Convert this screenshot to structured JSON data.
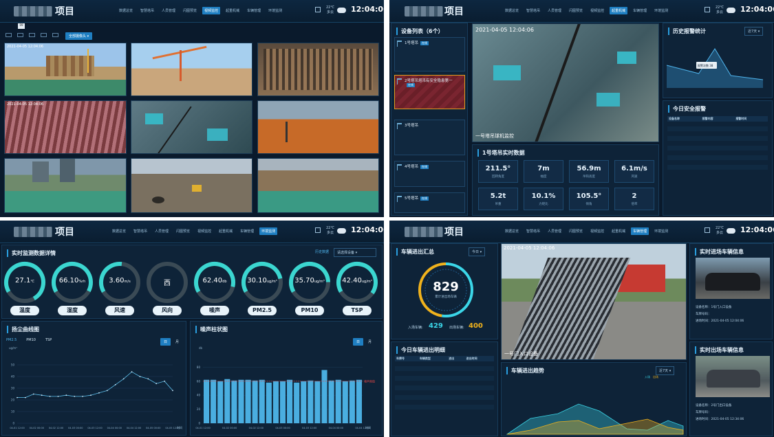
{
  "nav": [
    "数据总览",
    "智慧塔吊",
    "人员管理",
    "闪图预览",
    "视频监控",
    "起重机械",
    "车辆管理",
    "环境监测"
  ],
  "project_suffix": "项目",
  "time": "12:04:06",
  "weather": {
    "temp": "22℃",
    "desc": "多云",
    "icon": "cloud-icon"
  },
  "colors": {
    "accent": "#1f7fc2",
    "cyan": "#3bd6e8",
    "bg": "#0a1a2c"
  },
  "q1": {
    "top_label": "09",
    "dropdown": "全部摄像头",
    "cams": [
      {
        "ts": "2021-04-05 12:04:06",
        "scene": "sky-yellow"
      },
      {
        "ts": "",
        "scene": "sky-concrete"
      },
      {
        "ts": "",
        "scene": "rebar"
      },
      {
        "ts": "2021-04-05 12:04:06",
        "scene": "rebar-red"
      },
      {
        "ts": "",
        "scene": "crane-top"
      },
      {
        "ts": "",
        "scene": "orange-soil"
      },
      {
        "ts": "",
        "scene": "buildings"
      },
      {
        "ts": "",
        "scene": "workers"
      },
      {
        "ts": "",
        "scene": "site-wide"
      }
    ]
  },
  "q2": {
    "device_list_title": "设备列表（6个）",
    "devices": [
      {
        "name": "1号塔吊",
        "tag": "在线"
      },
      {
        "name": "2号塔吊塔吊有安全隐患第一",
        "tag": "在线",
        "alarm": true
      },
      {
        "name": "3号塔吊",
        "tag": ""
      },
      {
        "name": "4号塔吊",
        "tag": "在线"
      },
      {
        "name": "5号塔吊",
        "tag": "在线"
      }
    ],
    "video_ts": "2021-04-05 12:04:06",
    "video_caption": "一号塔吊球机监控",
    "realtime_title": "1号塔吊实时数据",
    "metrics": [
      {
        "v": "211.5°",
        "l": "回转角度"
      },
      {
        "v": "7m",
        "l": "幅度"
      },
      {
        "v": "56.9m",
        "l": "吊钩高度"
      },
      {
        "v": "6.1m/s",
        "l": "风速"
      },
      {
        "v": "5.2t",
        "l": "吊重"
      },
      {
        "v": "10.1%",
        "l": "力矩比"
      },
      {
        "v": "105.5°",
        "l": "倾角"
      },
      {
        "v": "2",
        "l": "倍率"
      }
    ],
    "history_title": "历史报警统计",
    "history_select": "近7天",
    "history_chart": {
      "type": "area",
      "values": [
        22,
        18,
        14,
        38,
        12,
        10,
        8
      ],
      "tooltip": "报警次数 38"
    },
    "safety_title": "今日安全报警",
    "safety_headers": [
      "设备名称",
      "报警内容",
      "报警时间"
    ],
    "safety_rows": 10
  },
  "q3": {
    "monitor_title": "实时监测数据详情",
    "monitor_link": "历史数据",
    "monitor_select": "请选择设备",
    "gauges": [
      {
        "v": "27.1",
        "u": "℃",
        "l": "温度",
        "p": 0.75
      },
      {
        "v": "66.10",
        "u": "%rh",
        "l": "湿度",
        "p": 0.66
      },
      {
        "v": "3.60",
        "u": "m/s",
        "l": "风速",
        "p": 0.35
      },
      {
        "v": "西",
        "u": "",
        "l": "风向",
        "p": 0
      },
      {
        "v": "62.40",
        "u": "db",
        "l": "噪声",
        "p": 0.62
      },
      {
        "v": "30.10",
        "u": "ug/m³",
        "l": "PM2.5",
        "p": 0.55
      },
      {
        "v": "35.70",
        "u": "ug/m³",
        "l": "PM10",
        "p": 0.58
      },
      {
        "v": "42.40",
        "u": "ug/m³",
        "l": "TSP",
        "p": 0.68
      }
    ],
    "dust_title": "扬尘曲线图",
    "dust_tabs": [
      "PM2.5",
      "PM10",
      "TSP"
    ],
    "dust_unit": "ug/m³",
    "dust_btns": [
      "日",
      "月"
    ],
    "noise_title": "噪声柱状图",
    "noise_unit": "db",
    "noise_limit": "噪声限值",
    "x_axis_label": "时间"
  },
  "chart_data": [
    {
      "type": "line",
      "ylabel": "ug/m³",
      "ylim": [
        0,
        60
      ],
      "yticks": [
        0,
        10,
        20,
        30,
        40,
        50
      ],
      "x": [
        "04-01 12:00",
        "04-02 00:00",
        "04-02 12:00",
        "04-03 00:00",
        "04-03 12:00",
        "04-04 00:00",
        "04-04 12:00",
        "04-05 00:00",
        "04-05 12:00"
      ],
      "values": [
        22,
        22,
        25,
        24,
        23,
        23,
        24,
        23,
        23,
        24,
        26,
        28,
        33,
        38,
        44,
        40,
        38,
        34,
        36,
        28
      ]
    },
    {
      "type": "bar",
      "ylabel": "db",
      "ylim": [
        0,
        100
      ],
      "yticks": [
        0,
        20,
        40,
        60,
        80
      ],
      "x": [
        "04-01 12:00",
        "04-02 00:00",
        "04-02 12:00",
        "04-03 00:00",
        "04-03 12:00",
        "04-04 00:00",
        "04-04 12:00"
      ],
      "values": [
        62,
        62,
        60,
        63,
        61,
        62,
        62,
        61,
        62,
        58,
        60,
        60,
        62,
        58,
        60,
        61,
        60,
        76,
        61,
        62,
        60,
        61,
        62
      ],
      "limit": 60
    }
  ],
  "q4": {
    "summary_title": "车辆进出汇总",
    "summary_select": "今日",
    "total": "829",
    "total_label": "累计进出场车辆",
    "in_label": "入场车辆:",
    "in_value": "429",
    "out_label": "出场车辆:",
    "out_value": "400",
    "detail_title": "今日车辆进出明细",
    "detail_headers": [
      "车牌号",
      "车辆类型",
      "进出",
      "进出时间"
    ],
    "detail_rows": 10,
    "video_ts": "2021-04-05 12:04:06",
    "video_caption": "一号门入口设备",
    "trend_title": "车辆进出趋势",
    "trend_select": "近7天",
    "trend_legend": [
      "入场",
      "出场"
    ],
    "in_title": "实时进场车辆信息",
    "out_title": "实时出场车辆信息",
    "in_info": [
      "设备名称：1号门入口设备",
      "车牌号码：",
      "进场时间：2021-04-05 12:04:06"
    ],
    "out_info": [
      "设备名称：2号门出口设备",
      "车牌号码：",
      "进场时间：2021-04-05 12:34:06"
    ]
  }
}
